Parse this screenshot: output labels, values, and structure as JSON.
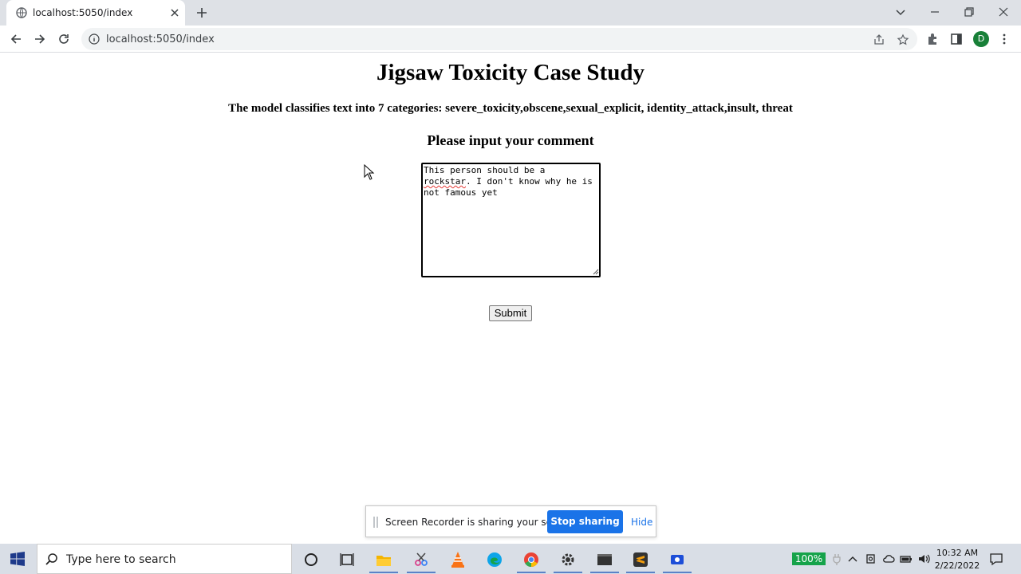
{
  "browser": {
    "tab_title": "localhost:5050/index",
    "url": "localhost:5050/index",
    "profile_initial": "D"
  },
  "page": {
    "title": "Jigsaw Toxicity Case Study",
    "description": "The model classifies text into 7 categories: severe_toxicity,obscene,sexual_explicit, identity_attack,insult, threat",
    "prompt": "Please input your comment",
    "comment_value_line1": "This person should be a",
    "comment_value_misspelled": "rockstar",
    "comment_value_rest": ". I don't know why he is not famous yet",
    "submit_label": "Submit"
  },
  "share_bar": {
    "message": "Screen Recorder is sharing your screen.",
    "stop_label": "Stop sharing",
    "hide_label": "Hide"
  },
  "taskbar": {
    "search_placeholder": "Type here to search",
    "battery": "100%",
    "time": "10:32 AM",
    "date": "2/22/2022"
  },
  "colors": {
    "accent": "#1a73e8",
    "profile": "#188038",
    "battery": "#16a34a"
  }
}
